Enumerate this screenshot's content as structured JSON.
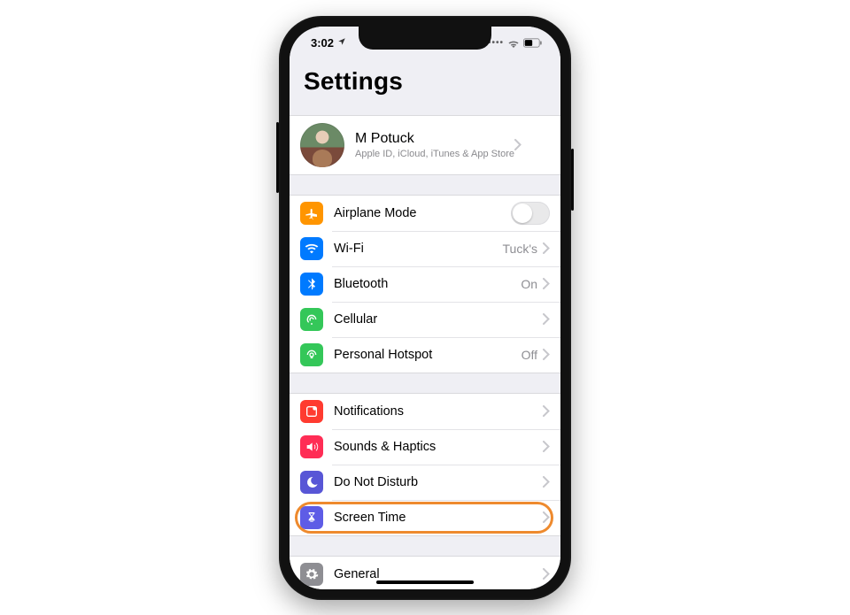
{
  "statusbar": {
    "time": "3:02"
  },
  "page_title": "Settings",
  "profile": {
    "name": "M Potuck",
    "subtitle": "Apple ID, iCloud, iTunes & App Store"
  },
  "groups": [
    {
      "rows": [
        {
          "icon": "airplane",
          "label": "Airplane Mode",
          "control": "toggle"
        },
        {
          "icon": "wifi",
          "label": "Wi-Fi",
          "value": "Tuck's",
          "chevron": true
        },
        {
          "icon": "bluetooth",
          "label": "Bluetooth",
          "value": "On",
          "chevron": true
        },
        {
          "icon": "cellular",
          "label": "Cellular",
          "chevron": true
        },
        {
          "icon": "hotspot",
          "label": "Personal Hotspot",
          "value": "Off",
          "chevron": true
        }
      ]
    },
    {
      "rows": [
        {
          "icon": "notifications",
          "label": "Notifications",
          "chevron": true
        },
        {
          "icon": "sounds",
          "label": "Sounds & Haptics",
          "chevron": true
        },
        {
          "icon": "dnd",
          "label": "Do Not Disturb",
          "chevron": true
        },
        {
          "icon": "screentime",
          "label": "Screen Time",
          "chevron": true,
          "highlight": true
        }
      ]
    },
    {
      "rows": [
        {
          "icon": "general",
          "label": "General",
          "chevron": true
        }
      ]
    }
  ],
  "colors": {
    "highlight": "#ee8a2e"
  }
}
